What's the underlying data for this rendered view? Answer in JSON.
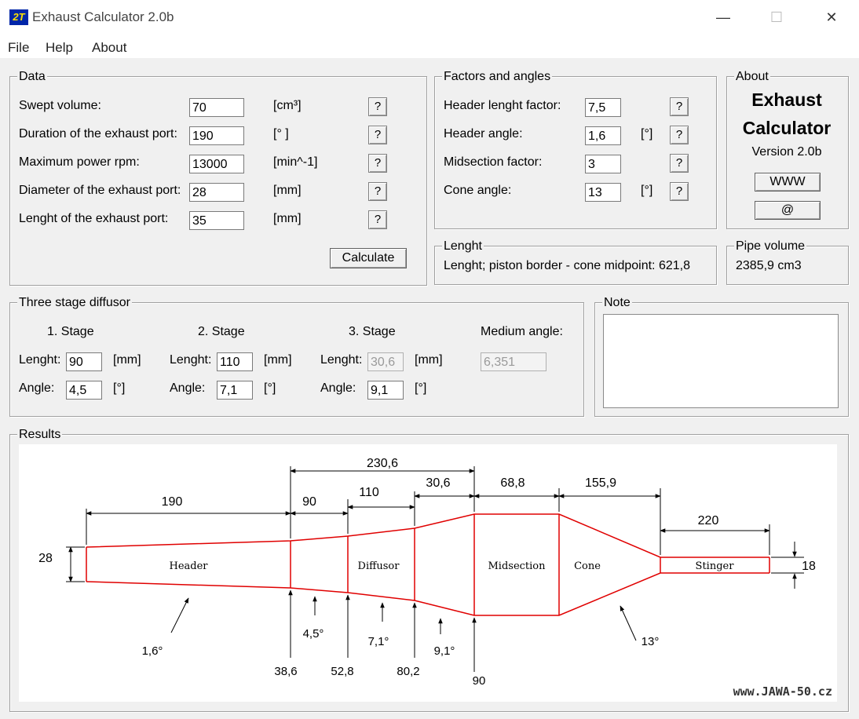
{
  "window": {
    "title": "Exhaust Calculator 2.0b",
    "app_icon": "2T",
    "minimize": "—",
    "maximize": "☐",
    "close": "✕"
  },
  "menu": [
    "File",
    "Help",
    "About"
  ],
  "data_group": {
    "title": "Data",
    "rows": [
      {
        "label": "Swept volume:",
        "value": "70",
        "unit": "[cm³]"
      },
      {
        "label": "Duration of the exhaust port:",
        "value": "190",
        "unit": "[° ]"
      },
      {
        "label": "Maximum power rpm:",
        "value": "13000",
        "unit": "[min^-1]"
      },
      {
        "label": "Diameter of the exhaust port:",
        "value": "28",
        "unit": "[mm]"
      },
      {
        "label": "Lenght of the exhaust port:",
        "value": "35",
        "unit": "[mm]"
      }
    ],
    "help_label": "?",
    "calculate_label": "Calculate"
  },
  "factors_group": {
    "title": "Factors and angles",
    "rows": [
      {
        "label": "Header lenght factor:",
        "value": "7,5",
        "unit": ""
      },
      {
        "label": "Header angle:",
        "value": "1,6",
        "unit": "[°]"
      },
      {
        "label": "Midsection factor:",
        "value": "3",
        "unit": ""
      },
      {
        "label": "Cone angle:",
        "value": "13",
        "unit": "[°]"
      }
    ]
  },
  "about_group": {
    "title": "About",
    "line1": "Exhaust",
    "line2": "Calculator",
    "version": "Version 2.0b",
    "www_label": "WWW",
    "at_label": "@"
  },
  "length_group": {
    "title": "Lenght",
    "text": "Lenght; piston border - cone midpoint:  621,8"
  },
  "pipe_group": {
    "title": "Pipe volume",
    "text": "2385,9 cm3"
  },
  "diffusor_group": {
    "title": "Three stage diffusor",
    "length_label": "Lenght:",
    "angle_label": "Angle:",
    "length_unit": "[mm]",
    "angle_unit": "[°]",
    "stages": [
      {
        "title": "1. Stage",
        "length": "90",
        "angle": "4,5"
      },
      {
        "title": "2. Stage",
        "length": "110",
        "angle": "7,1"
      },
      {
        "title": "3. Stage",
        "length": "30,6",
        "angle": "9,1"
      }
    ],
    "medium_title": "Medium angle:",
    "medium_value": "6,351"
  },
  "note_group": {
    "title": "Note",
    "value": ""
  },
  "results": {
    "title": "Results",
    "dims": {
      "total": "230,6",
      "header": "190",
      "s1": "90",
      "s2": "110",
      "s3": "30,6",
      "mid": "68,8",
      "cone": "155,9",
      "stinger": "220"
    },
    "diam_in": "28",
    "diam_out": "18",
    "sections": {
      "header": "Header",
      "diffusor": "Diffusor",
      "midsection": "Midsection",
      "cone": "Cone",
      "stinger": "Stinger"
    },
    "angles": {
      "header": "1,6°",
      "s1": "4,5°",
      "s2": "7,1°",
      "s3": "9,1°",
      "cone": "13°"
    },
    "diameters": {
      "d1": "38,6",
      "d2": "52,8",
      "d3": "80,2",
      "d4": "90"
    },
    "watermark": "www.JAWA-50.cz"
  },
  "colors": {
    "pipe": "#e00000",
    "dim": "#000000"
  }
}
